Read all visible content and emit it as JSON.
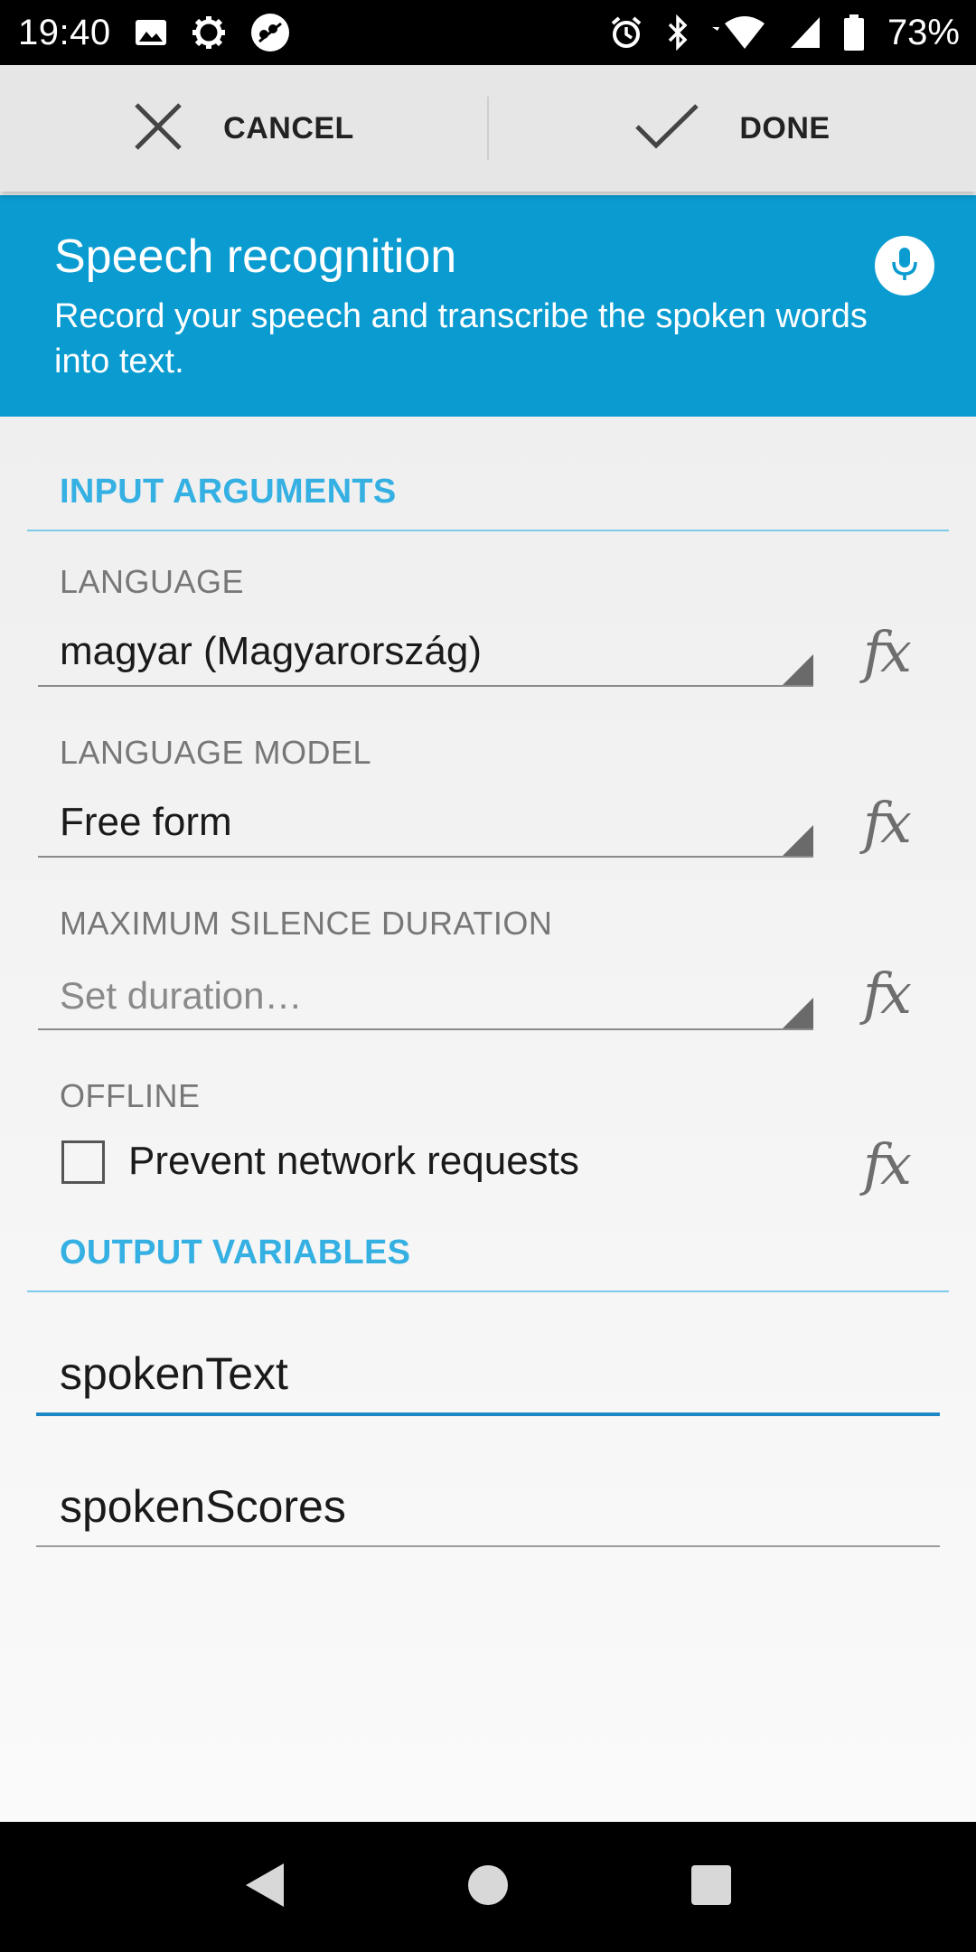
{
  "status_bar": {
    "time": "19:40",
    "battery": "73%",
    "left_icons": [
      "image-icon",
      "settings-gear-icon",
      "app-notification-icon"
    ],
    "right_icons": [
      "alarm-icon",
      "bluetooth-icon",
      "wifi-icon",
      "cell-signal-icon",
      "battery-icon"
    ]
  },
  "action_bar": {
    "cancel_label": "CANCEL",
    "done_label": "DONE"
  },
  "banner": {
    "title": "Speech recognition",
    "subtitle": "Record your speech and transcribe the spoken words into text.",
    "color": "#0a9bd0"
  },
  "input_section": {
    "header": "INPUT ARGUMENTS",
    "language": {
      "label": "LANGUAGE",
      "value": "magyar (Magyarország)"
    },
    "language_model": {
      "label": "LANGUAGE MODEL",
      "value": "Free form"
    },
    "max_silence": {
      "label": "MAXIMUM SILENCE DURATION",
      "placeholder": "Set duration…"
    },
    "offline": {
      "label": "OFFLINE",
      "checkbox_label": "Prevent network requests",
      "checked": false
    },
    "fx_symbol": "fx"
  },
  "output_section": {
    "header": "OUTPUT VARIABLES",
    "variables": [
      "spokenText",
      "spokenScores"
    ]
  },
  "colors": {
    "accent": "#35b0e3",
    "focus_underline": "#1e88c7"
  }
}
